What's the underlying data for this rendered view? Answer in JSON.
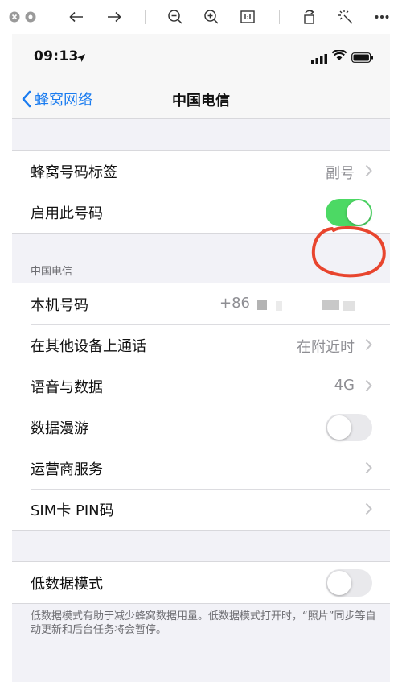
{
  "toolbar": {
    "icons": [
      "close-window-icon",
      "settings-icon",
      "back-arrow-icon",
      "forward-arrow-icon",
      "zoom-out-icon",
      "zoom-in-icon",
      "actual-size-icon",
      "rotate-icon",
      "magic-wand-icon",
      "more-icon"
    ]
  },
  "status_bar": {
    "time": "09:13",
    "icons": [
      "location-arrow-icon",
      "cellular-signal-icon",
      "wifi-icon",
      "battery-icon"
    ]
  },
  "nav": {
    "back_label": "蜂窝网络",
    "title": "中国电信"
  },
  "group1": [
    {
      "label": "蜂窝号码标签",
      "value": "副号",
      "chevron": true
    },
    {
      "label": "启用此号码",
      "toggle": "on"
    }
  ],
  "section_header": "中国电信",
  "group2": [
    {
      "label": "本机号码",
      "value": "+86"
    },
    {
      "label": "在其他设备上通话",
      "value": "在附近时",
      "chevron": true
    },
    {
      "label": "语音与数据",
      "value": "4G",
      "chevron": true
    },
    {
      "label": "数据漫游",
      "toggle": "off"
    },
    {
      "label": "运营商服务",
      "chevron": true
    },
    {
      "label": "SIM卡 PIN码",
      "chevron": true
    }
  ],
  "group3": [
    {
      "label": "低数据模式",
      "toggle": "off"
    }
  ],
  "footnote": "低数据模式有助于减少蜂窝数据用量。低数据模式打开时，“照片”同步等自动更新和后台任务将会暂停。",
  "colors": {
    "accent": "#1a7cf0",
    "toggle_on": "#4cd964",
    "annotation": "#e8452e"
  }
}
